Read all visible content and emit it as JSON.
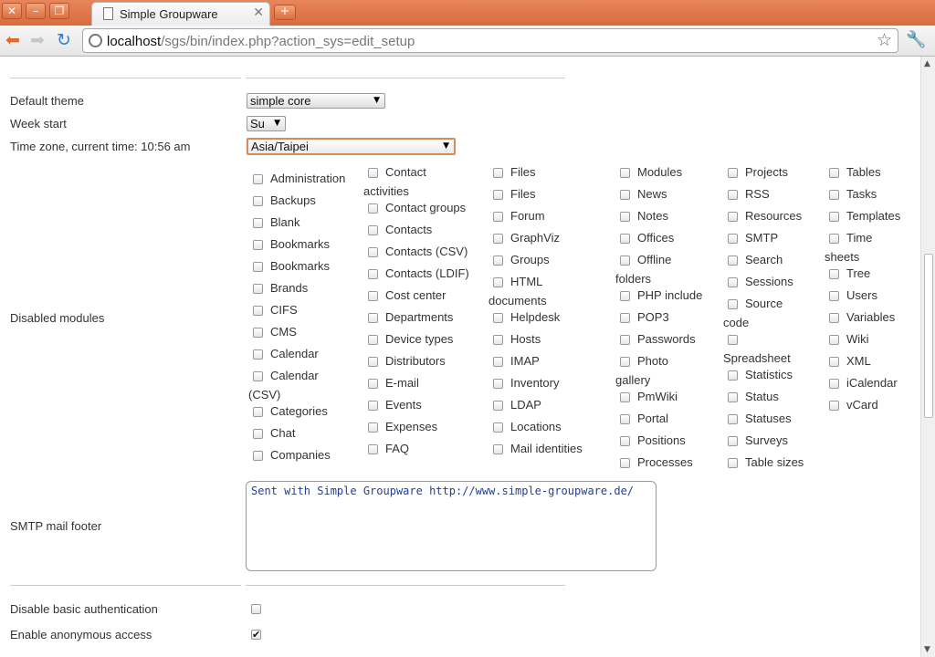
{
  "browser": {
    "tab_title": "Simple Groupware",
    "url_host": "localhost",
    "url_path": "/sgs/bin/index.php?action_sys=edit_setup"
  },
  "settings": {
    "default_theme": {
      "label": "Default theme",
      "value": "simple core"
    },
    "week_start": {
      "label": "Week start",
      "value": "Su"
    },
    "time_zone": {
      "label": "Time zone, current time: 10:56 am",
      "value": "Asia/Taipei"
    },
    "disabled_modules_label": "Disabled modules",
    "modules": {
      "col1": [
        "Administration",
        "Backups",
        "Blank",
        "Bookmarks",
        "Bookmarks",
        "Brands",
        "CIFS",
        "CMS",
        "Calendar",
        "Calendar",
        "Categories",
        "Chat",
        "Companies"
      ],
      "col1_wrap": "(CSV)",
      "col2": [
        "Contact",
        "Contact groups",
        "Contacts",
        "Contacts (CSV)",
        "Contacts (LDIF)",
        "Cost center",
        "Departments",
        "Device types",
        "Distributors",
        "E-mail",
        "Events",
        "Expenses",
        "FAQ"
      ],
      "col2_wrap": "activities",
      "col3": [
        "Files",
        "Files",
        "Forum",
        "GraphViz",
        "Groups",
        "HTML",
        "Helpdesk",
        "Hosts",
        "IMAP",
        "Inventory",
        "LDAP",
        "Locations",
        "Mail identities"
      ],
      "col3_wrap": "documents",
      "col4": [
        "Modules",
        "News",
        "Notes",
        "Offices",
        "Offline",
        "PHP include",
        "POP3",
        "Passwords",
        "Photo",
        "PmWiki",
        "Portal",
        "Positions",
        "Processes"
      ],
      "col4_wrap1": "folders",
      "col4_wrap2": "gallery",
      "col5": [
        "Projects",
        "RSS",
        "Resources",
        "SMTP",
        "Search",
        "Sessions",
        "Source",
        "",
        "Statistics",
        "Status",
        "Statuses",
        "Surveys",
        "Table sizes"
      ],
      "col5_wrap1": "code",
      "col5_wrap2": "Spreadsheet",
      "col6": [
        "Tables",
        "Tasks",
        "Templates",
        "Time",
        "Tree",
        "Users",
        "Variables",
        "Wiki",
        "XML",
        "iCalendar",
        "vCard"
      ],
      "col6_wrap": "sheets"
    },
    "smtp_footer": {
      "label": "SMTP mail footer",
      "value": "Sent with Simple Groupware http://www.simple-groupware.de/"
    },
    "disable_basic_auth": {
      "label": "Disable basic authentication",
      "checked": false
    },
    "enable_anonymous": {
      "label": "Enable anonymous access",
      "checked": true
    }
  }
}
